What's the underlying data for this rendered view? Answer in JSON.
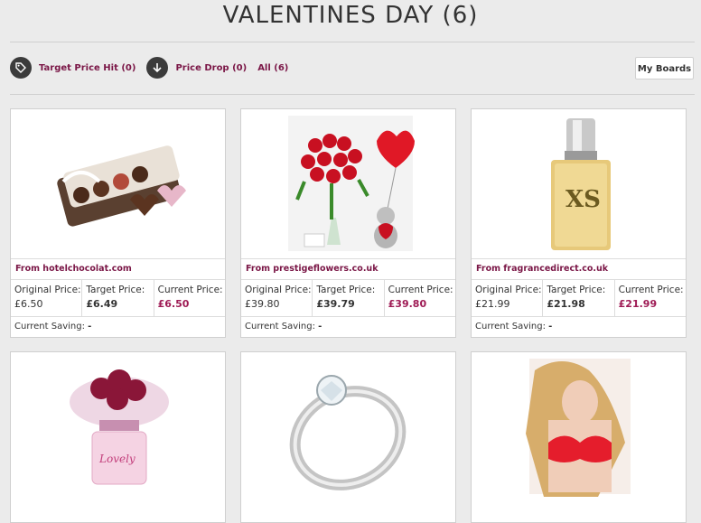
{
  "page_title": "VALENTINES DAY (6)",
  "filters": {
    "target_hit": "Target Price Hit (0)",
    "price_drop": "Price Drop (0)",
    "all": "All (6)"
  },
  "my_boards": "My Boards",
  "labels": {
    "original": "Original Price:",
    "target": "Target Price:",
    "current": "Current Price:",
    "saving": "Current Saving:"
  },
  "products": [
    {
      "from": "From hotelchocolat.com",
      "original": "£6.50",
      "target": "£6.49",
      "current": "£6.50",
      "saving": "-",
      "image": "chocolates"
    },
    {
      "from": "From prestigeflowers.co.uk",
      "original": "£39.80",
      "target": "£39.79",
      "current": "£39.80",
      "saving": "-",
      "image": "roses"
    },
    {
      "from": "From fragrancedirect.co.uk",
      "original": "£21.99",
      "target": "£21.98",
      "current": "£21.99",
      "saving": "-",
      "image": "perfume-xs"
    },
    {
      "image": "perfume-pink"
    },
    {
      "image": "ring"
    },
    {
      "image": "lingerie"
    }
  ],
  "colors": {
    "accent": "#7a1646",
    "price": "#9e1a54",
    "background": "#ebebeb"
  }
}
